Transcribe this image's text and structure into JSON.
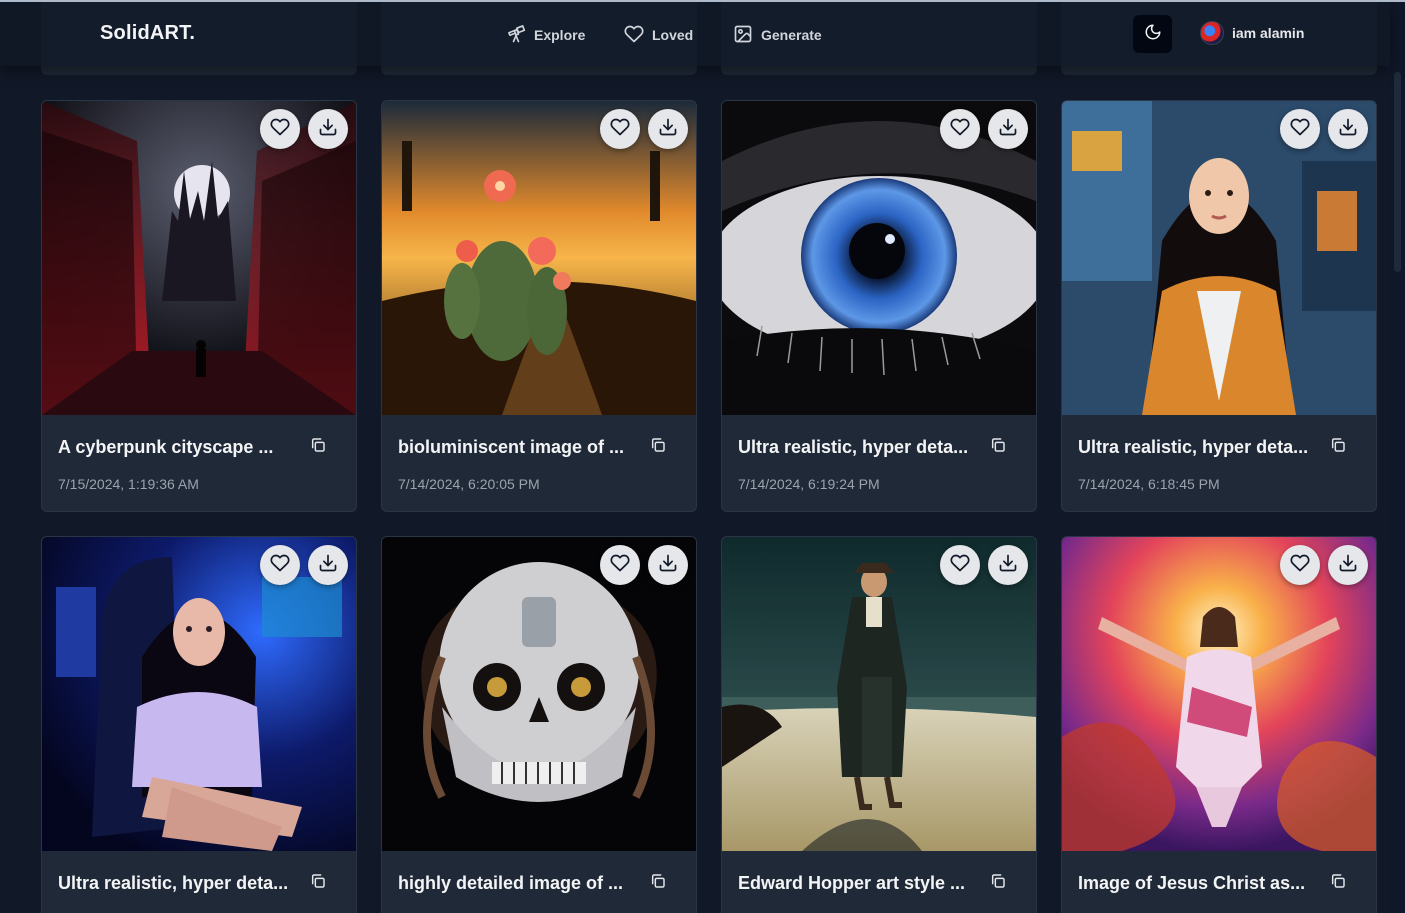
{
  "navbar": {
    "brand": "SolidART.",
    "links": [
      {
        "label": "Explore",
        "icon": "telescope-icon"
      },
      {
        "label": "Loved",
        "icon": "heart-icon"
      },
      {
        "label": "Generate",
        "icon": "image-icon"
      }
    ],
    "theme_icon": "moon-icon",
    "user_name": "iam alamin"
  },
  "gallery": [
    {
      "title": "A cyberpunk cityscape ...",
      "date": "7/15/2024, 1:19:36 AM"
    },
    {
      "title": "bioluminiscent image of ...",
      "date": "7/14/2024, 6:20:05 PM"
    },
    {
      "title": "Ultra realistic, hyper deta...",
      "date": "7/14/2024, 6:19:24 PM"
    },
    {
      "title": "Ultra realistic, hyper deta...",
      "date": "7/14/2024, 6:18:45 PM"
    },
    {
      "title": "Ultra realistic, hyper deta...",
      "date": ""
    },
    {
      "title": "highly detailed image of ...",
      "date": ""
    },
    {
      "title": "Edward Hopper art style ...",
      "date": ""
    },
    {
      "title": "Image of Jesus Christ as...",
      "date": ""
    }
  ],
  "colors": {
    "page_bg": "#111827",
    "card_bg": "#1f2937",
    "button_bg": "#e5e7eb",
    "text_primary": "#f3f4f6",
    "text_muted": "#9ca3af"
  }
}
